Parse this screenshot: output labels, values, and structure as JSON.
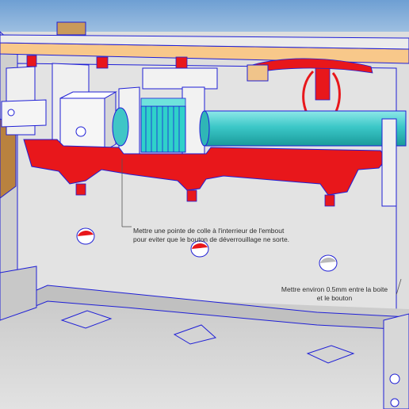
{
  "annotations": {
    "glue_note": {
      "line1": "Mettre une pointe de colle à l'interrieur de l'embout",
      "line2": "pour eviter que le bouton de déverrouillage ne sorte."
    },
    "gap_note": {
      "line1": "Mettre environ 0.5mm entre la boite",
      "line2": "et le bouton"
    }
  },
  "colors": {
    "background_sky": "#8ab3da",
    "box_wall": "#dcdcdc",
    "box_wall_shadow": "#b9b9b9",
    "clip_red": "#e8171b",
    "rod_cyan": "#32c6c6",
    "gear_cyan": "#2fd1c9",
    "top_rail": "#f8c88a",
    "wood_block": "#b9823f",
    "edge_blue": "#1f1fd6"
  }
}
